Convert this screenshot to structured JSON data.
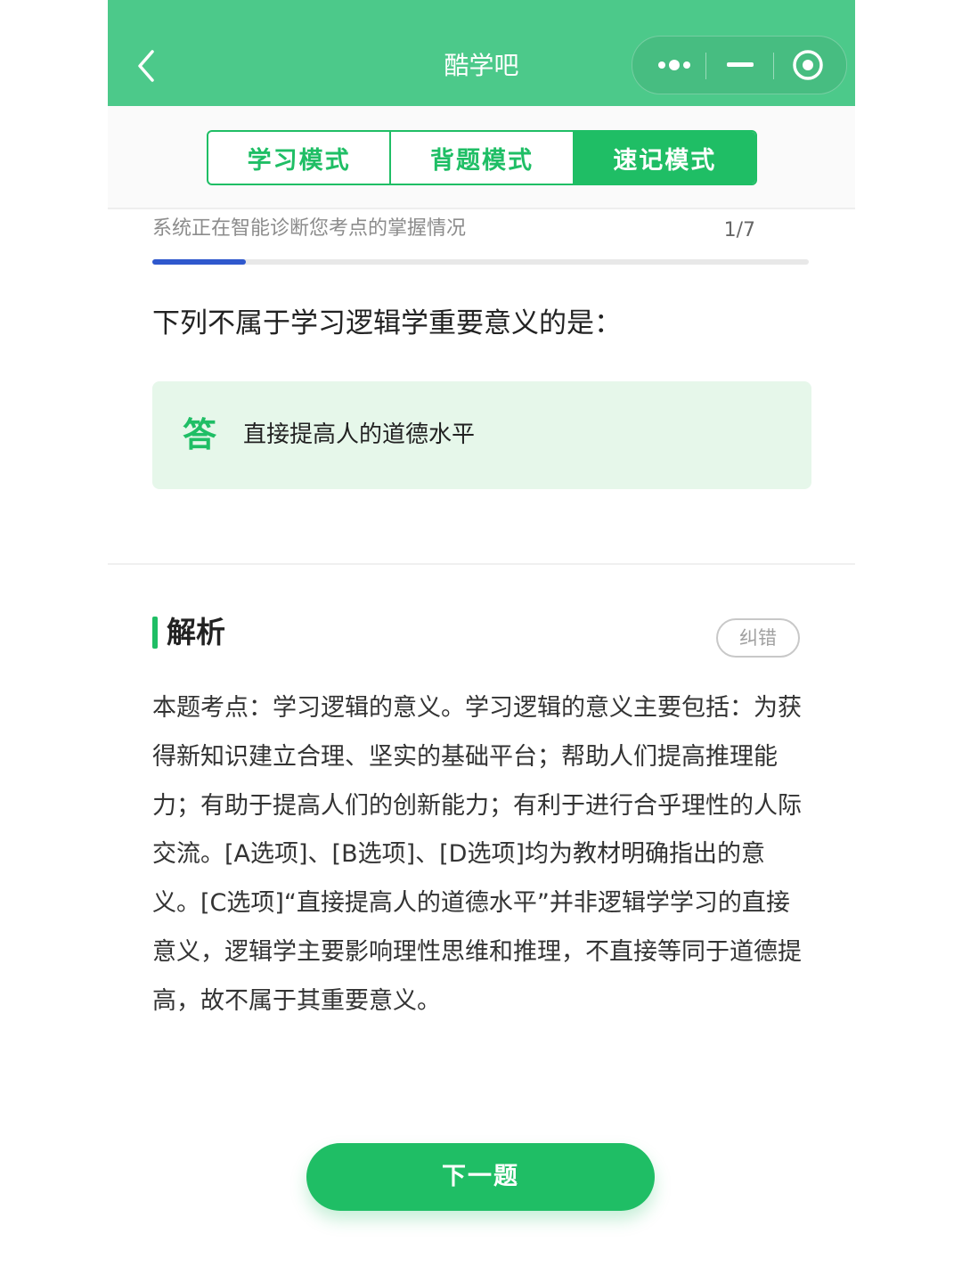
{
  "header": {
    "title": "酷学吧"
  },
  "tabs": [
    {
      "label": "学习模式",
      "active": false
    },
    {
      "label": "背题模式",
      "active": false
    },
    {
      "label": "速记模式",
      "active": true
    }
  ],
  "progress": {
    "status_text": "系统正在智能诊断您考点的掌握情况",
    "count_text": "1/7",
    "current": 1,
    "total": 7
  },
  "question": {
    "text": "下列不属于学习逻辑学重要意义的是："
  },
  "answer": {
    "tag": "答",
    "text": "直接提高人的道德水平"
  },
  "analysis": {
    "title": "解析",
    "report_label": "纠错",
    "body": "本题考点：学习逻辑的意义。学习逻辑的意义主要包括：为获得新知识建立合理、坚实的基础平台；帮助人们提高推理能力；有助于提高人们的创新能力；有利于进行合乎理性的人际交流。[A选项]、[B选项]、[D选项]均为教材明确指出的意义。[C选项]“直接提高人的道德水平”并非逻辑学学习的直接意义，逻辑学主要影响理性思维和推理，不直接等同于道德提高，故不属于其重要意义。"
  },
  "footer": {
    "next_label": "下一题"
  },
  "colors": {
    "header_bg": "#4cc98a",
    "accent": "#1fbe65",
    "progress": "#2f58cd",
    "answer_bg": "#e6f7ea"
  }
}
